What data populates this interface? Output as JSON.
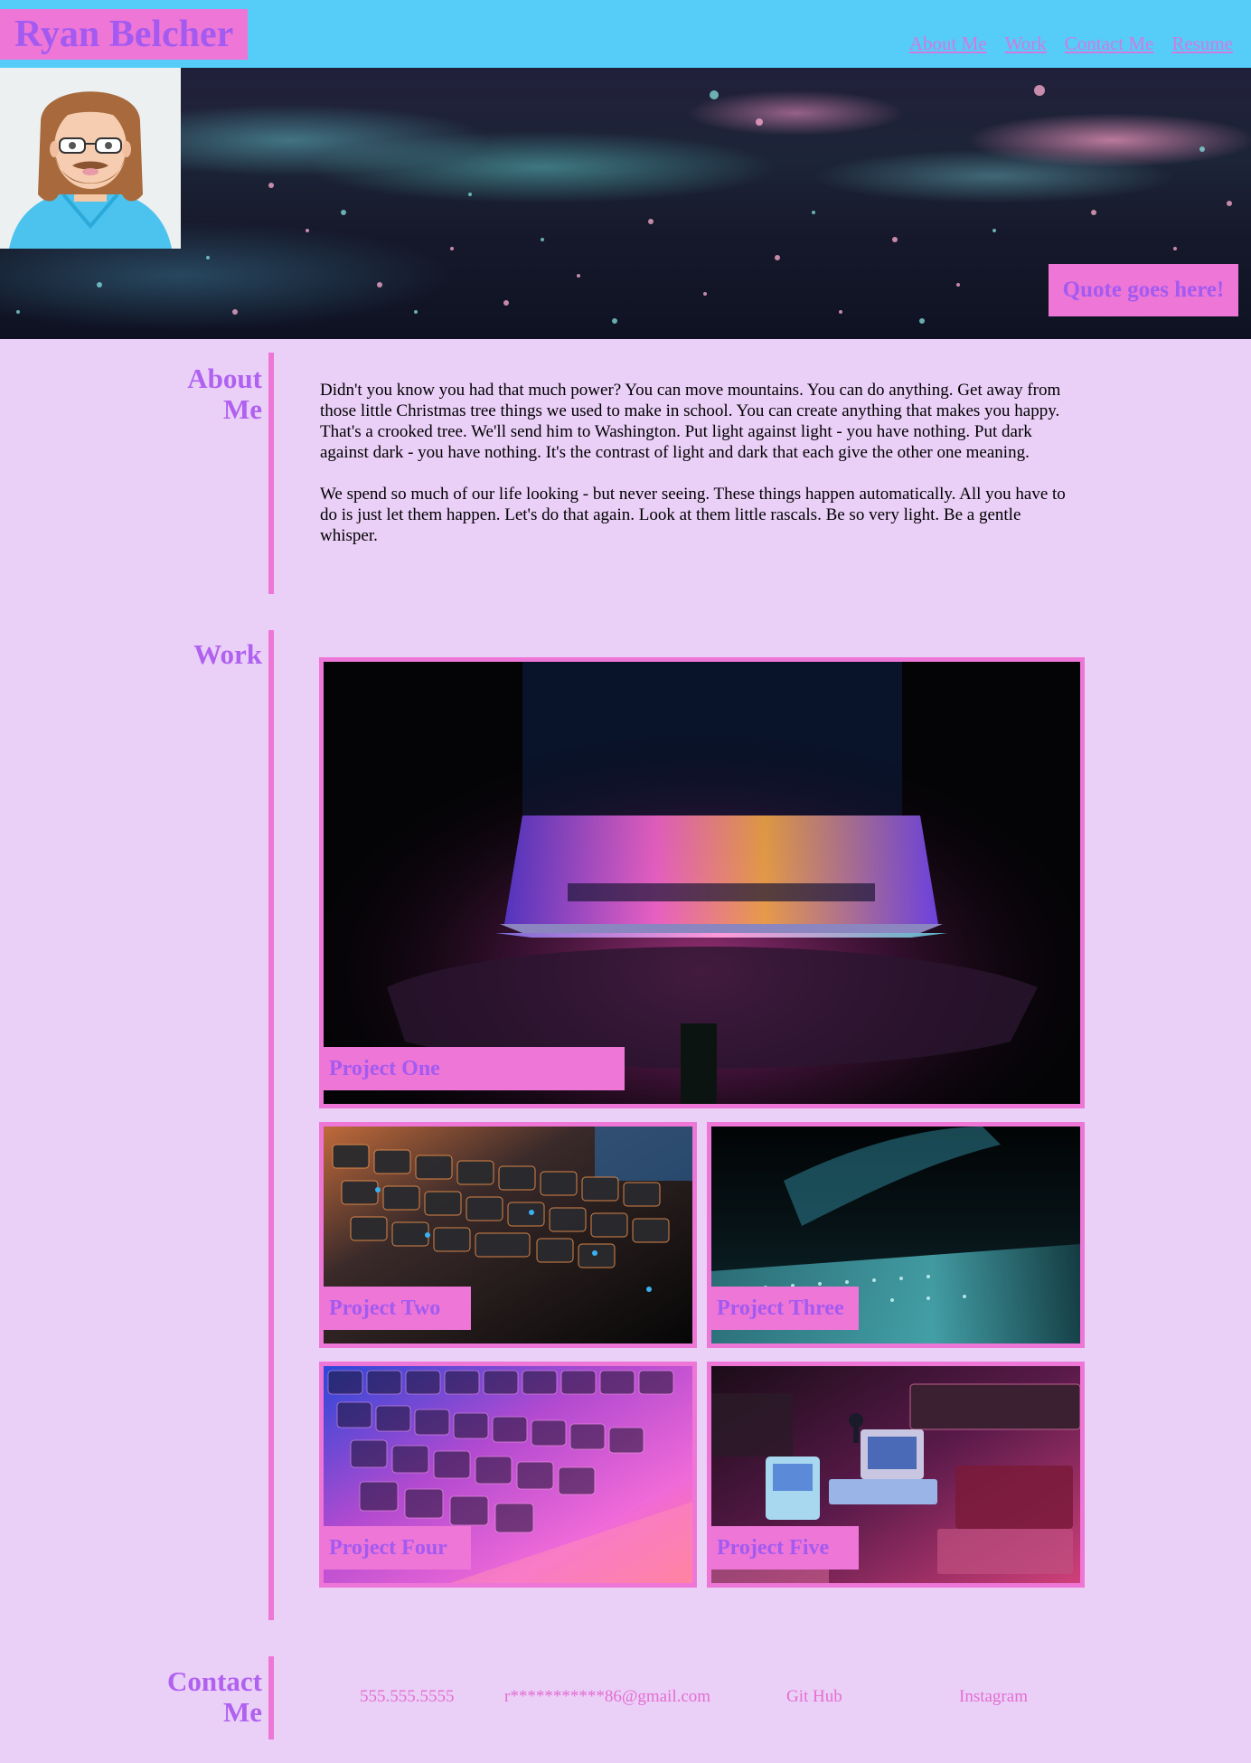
{
  "header": {
    "title": "Ryan Belcher",
    "nav": [
      "About Me",
      "Work",
      "Contact Me",
      "Resume"
    ]
  },
  "hero": {
    "quote": "Quote goes here!"
  },
  "about": {
    "heading_line1": "About",
    "heading_line2": "Me",
    "paragraphs": [
      "Didn't you know you had that much power? You can move mountains. You can do anything. Get away from those little Christmas tree things we used to make in school. You can create anything that makes you happy. That's a crooked tree. We'll send him to Washington. Put light against light - you have nothing. Put dark against dark - you have nothing. It's the contrast of light and dark that each give the other one meaning.",
      "We spend so much of our life looking - but never seeing. These things happen automatically. All you have to do is just let them happen. Let's do that again. Look at them little rascals. Be so very light. Be a gentle whisper."
    ]
  },
  "work": {
    "heading": "Work",
    "projects": [
      "Project One",
      "Project Two",
      "Project Three",
      "Project Four",
      "Project Five"
    ]
  },
  "contact": {
    "heading_line1": "Contact",
    "heading_line2": "Me",
    "phone": "555.555.5555",
    "email": "r***********86@gmail.com",
    "github": "Git Hub",
    "instagram": "Instagram"
  },
  "colors": {
    "page_bg": "#eacff7",
    "header_bg": "#55cdf8",
    "accent_pink": "#ee76d7",
    "accent_purple": "#a35af0"
  }
}
